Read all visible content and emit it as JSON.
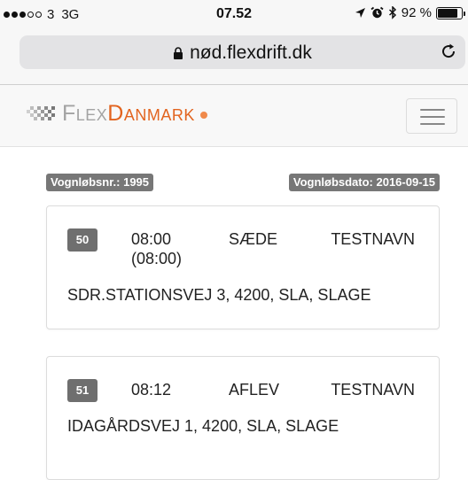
{
  "status_bar": {
    "signal_dots": [
      true,
      true,
      true,
      false,
      false
    ],
    "carrier": "3",
    "network": "3G",
    "time": "07.52",
    "battery_percent_label": "92 %",
    "battery_level": 0.92,
    "icons": [
      "location-arrow-icon",
      "alarm-clock-icon",
      "bluetooth-icon",
      "battery-icon"
    ]
  },
  "browser": {
    "url": "nød.flexdrift.dk",
    "lock_icon": "lock-icon",
    "reload_icon": "reload-icon"
  },
  "navbar": {
    "logo_part1": "Flex",
    "logo_part2": "Danmark",
    "menu_icon": "hamburger-menu-icon",
    "colors": {
      "logo_grey": "#a3a3a3",
      "logo_orange": "#e2641f"
    }
  },
  "route": {
    "number_label": "Vognløbsnr.: 1995",
    "date_label": "Vognløbsdato: 2016-09-15"
  },
  "stops": [
    {
      "number": "50",
      "time": "08:00",
      "time_planned": "(08:00)",
      "action": "SÆDE",
      "name": "TESTNAVN",
      "address": "SDR.STATIONSVEJ 3, 4200, SLA, SLAGE"
    },
    {
      "number": "51",
      "time": "08:12",
      "action": "AFLEV",
      "name": "TESTNAVN",
      "address": "IDAGÅRDSVEJ 1, 4200, SLA, SLAGE"
    }
  ]
}
